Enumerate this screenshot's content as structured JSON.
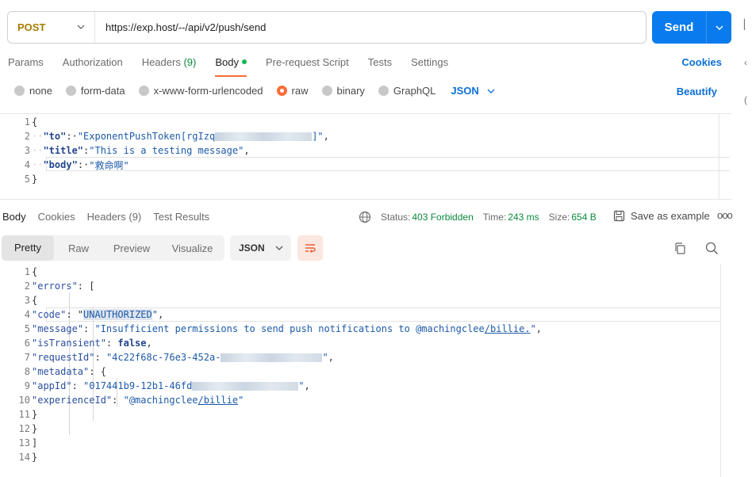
{
  "request": {
    "method": "POST",
    "url": "https://exp.host/--/api/v2/push/send",
    "send_label": "Send"
  },
  "request_tabs": [
    {
      "label": "Params"
    },
    {
      "label": "Authorization"
    },
    {
      "label": "Headers",
      "count": "(9)"
    },
    {
      "label": "Body"
    },
    {
      "label": "Pre-request Script"
    },
    {
      "label": "Tests"
    },
    {
      "label": "Settings"
    }
  ],
  "cookies_label": "Cookies",
  "body_types": [
    "none",
    "form-data",
    "x-www-form-urlencoded",
    "raw",
    "binary",
    "GraphQL"
  ],
  "body_format": "JSON",
  "beautify_label": "Beautify",
  "request_body": {
    "line_numbers": [
      "1",
      "2",
      "3",
      "4",
      "5"
    ],
    "open": "{",
    "close": "}",
    "to_key": "\"to\"",
    "to_val_prefix": "\"ExponentPushToken[rgIzq",
    "to_val_suffix": "]\"",
    "title_key": "\"title\"",
    "title_val": "\"This is a testing message\"",
    "body_key": "\"body\"",
    "body_val": "\"救命啊\""
  },
  "response_tabs": [
    "Body",
    "Cookies",
    "Headers (9)",
    "Test Results"
  ],
  "response_meta": {
    "status_label": "Status:",
    "status_value": "403 Forbidden",
    "time_label": "Time:",
    "time_value": "243 ms",
    "size_label": "Size:",
    "size_value": "654 B",
    "save_label": "Save as example",
    "more": "ooo"
  },
  "view_modes": [
    "Pretty",
    "Raw",
    "Preview",
    "Visualize"
  ],
  "response_format": "JSON",
  "response_body": {
    "line_numbers": [
      "1",
      "2",
      "3",
      "4",
      "5",
      "6",
      "7",
      "8",
      "9",
      "10",
      "11",
      "12",
      "13",
      "14"
    ],
    "l1": "{",
    "errors_key": "\"errors\"",
    "errors_open": "[",
    "obj_open": "{",
    "code_key": "\"code\"",
    "code_val": "UNAUTHORIZED",
    "message_key": "\"message\"",
    "message_val_a": "\"Insufficient permissions to send push notifications to @machingclee",
    "message_val_b": "/billie.",
    "message_val_c": "\"",
    "transient_key": "\"isTransient\"",
    "transient_val": "false",
    "request_key": "\"requestId\"",
    "request_val": "\"4c22f68c-76e3-452a-",
    "metadata_key": "\"metadata\"",
    "appid_key": "\"appId\"",
    "appid_val": "\"017441b9-12b1-46fd",
    "exp_key": "\"experienceId\"",
    "exp_val_a": "\"@machingclee",
    "exp_val_b": "/billie",
    "meta_close": "}",
    "obj_close": "}",
    "arr_close": "]",
    "l14": "}"
  },
  "colors": {
    "send": "#097bed",
    "method": "#a77d00",
    "active_tab_underline": "#ff6c37",
    "status_ok": "#0b8a3e",
    "link": "#0b6fd8"
  },
  "icons": [
    "chevron-down-icon",
    "globe-icon",
    "save-icon",
    "wrap-icon",
    "copy-icon",
    "search-icon"
  ]
}
